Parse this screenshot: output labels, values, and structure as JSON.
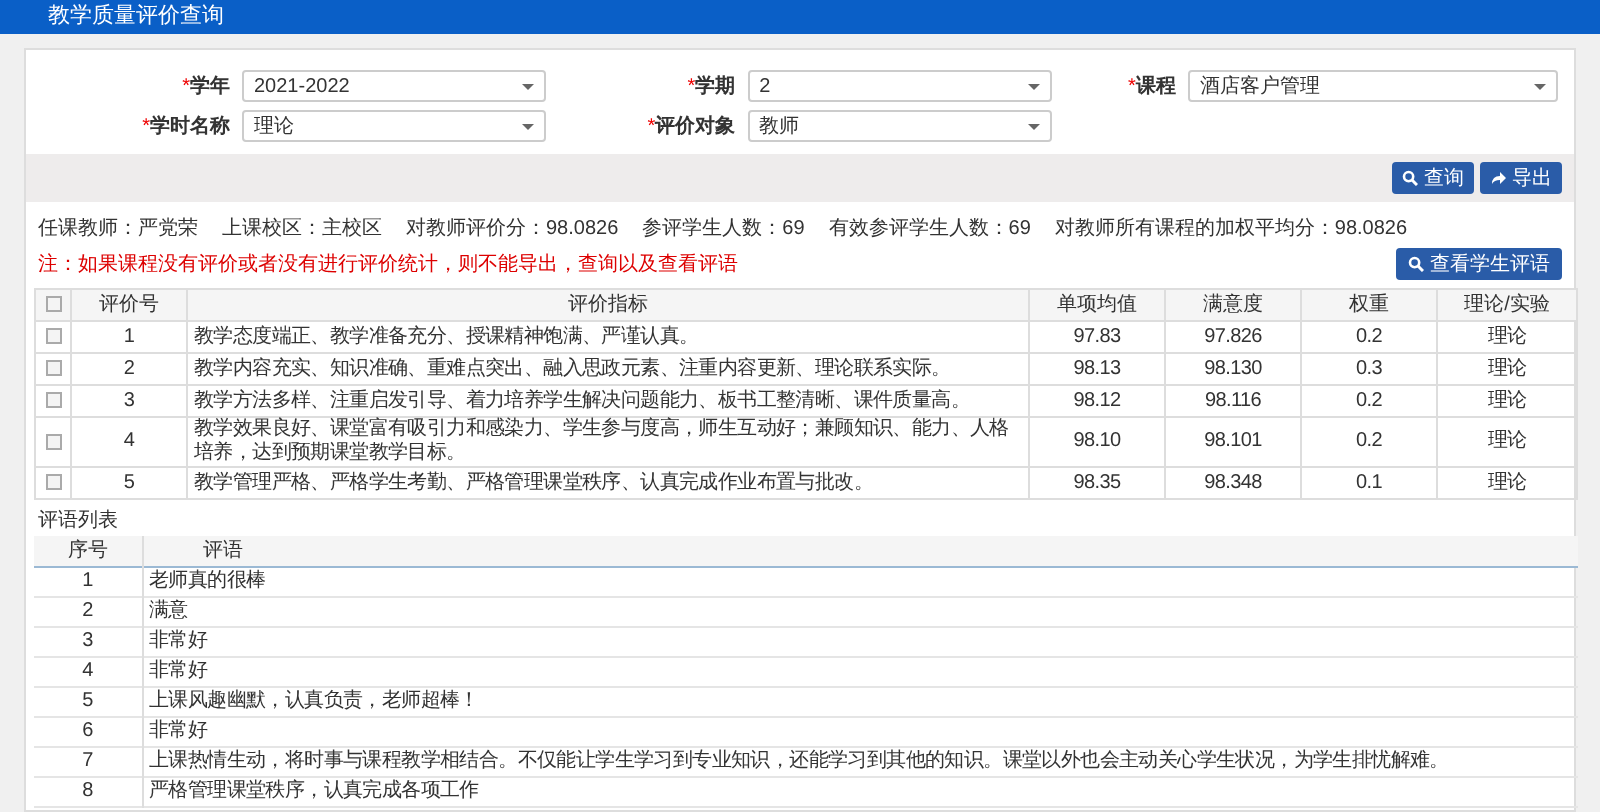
{
  "window": {
    "title": "教学质量评价查询"
  },
  "filters": [
    {
      "label": "学年",
      "required_mark": "*",
      "value": "2021-2022"
    },
    {
      "label": "学期",
      "required_mark": "*",
      "value": "2"
    },
    {
      "label": "课程",
      "required_mark": "*",
      "value": "酒店客户管理"
    },
    {
      "label": "学时名称",
      "required_mark": "*",
      "value": "理论"
    },
    {
      "label": "评价对象",
      "required_mark": "*",
      "value": "教师"
    }
  ],
  "actions": [
    {
      "label": "查询",
      "kind": "search"
    },
    {
      "label": "导出",
      "kind": "export"
    }
  ],
  "summary": [
    "任课教师：严党荣",
    "上课校区：主校区",
    "对教师评价分：98.0826",
    "参评学生人数：69",
    "有效参评学生人数：69",
    "对教师所有课程的加权平均分：98.0826"
  ],
  "note": "注：如果课程没有评价或者没有进行评价统计，则不能导出，查询以及查看评语",
  "view_comments_button": "查看学生评语",
  "indicators": {
    "all_checked": false,
    "columns": [
      "评价号",
      "评价指标",
      "单项均值",
      "满意度",
      "权重",
      "理论/实验"
    ],
    "rows": [
      {
        "checked": false,
        "cells": [
          "1",
          "教学态度端正、教学准备充分、授课精神饱满、严谨认真。",
          "97.83",
          "97.826",
          "0.2",
          "理论"
        ]
      },
      {
        "checked": false,
        "cells": [
          "2",
          "教学内容充实、知识准确、重难点突出、融入思政元素、注重内容更新、理论联系实际。",
          "98.13",
          "98.130",
          "0.3",
          "理论"
        ]
      },
      {
        "checked": false,
        "cells": [
          "3",
          "教学方法多样、注重启发引导、着力培养学生解决问题能力、板书工整清晰、课件质量高。",
          "98.12",
          "98.116",
          "0.2",
          "理论"
        ]
      },
      {
        "checked": false,
        "cells": [
          "4",
          "教学效果良好、课堂富有吸引力和感染力、学生参与度高，师生互动好；兼顾知识、能力、人格培养，达到预期课堂教学目标。",
          "98.10",
          "98.101",
          "0.2",
          "理论"
        ]
      },
      {
        "checked": false,
        "cells": [
          "5",
          "教学管理严格、严格学生考勤、严格管理课堂秩序、认真完成作业布置与批改。",
          "98.35",
          "98.348",
          "0.1",
          "理论"
        ]
      }
    ]
  },
  "comments": {
    "title": "评语列表",
    "columns": [
      "序号",
      "评语"
    ],
    "rows": [
      [
        "1",
        "老师真的很棒"
      ],
      [
        "2",
        "满意"
      ],
      [
        "3",
        "非常好"
      ],
      [
        "4",
        "非常好"
      ],
      [
        "5",
        "上课风趣幽默，认真负责，老师超棒！"
      ],
      [
        "6",
        "非常好"
      ],
      [
        "7",
        "上课热情生动，将时事与课程教学相结合。不仅能让学生学习到专业知识，还能学习到其他的知识。课堂以外也会主动关心学生状况，为学生排忧解难。"
      ],
      [
        "8",
        "严格管理课堂秩序，认真完成各项工作"
      ]
    ]
  }
}
